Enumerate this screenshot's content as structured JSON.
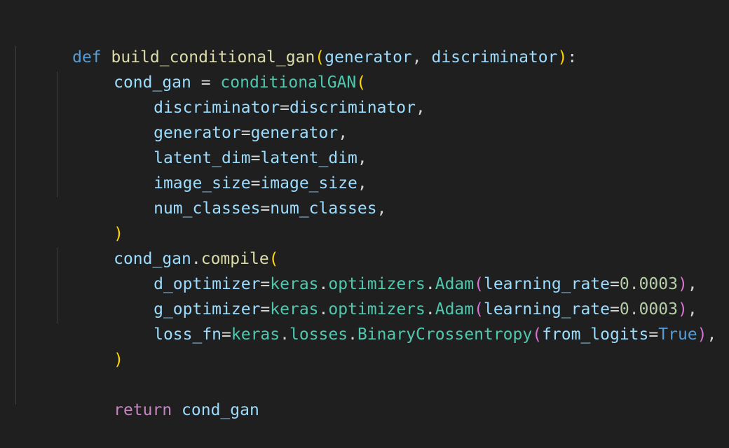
{
  "code": {
    "l1": {
      "kw": "def",
      "fn": "build_conditional_gan",
      "open": "(",
      "p1": "generator",
      "comma": ", ",
      "p2": "discriminator",
      "close": ")",
      "colon": ":"
    },
    "l2": {
      "var": "cond_gan",
      "eq": " = ",
      "cls": "conditionalGAN",
      "open": "("
    },
    "args1": [
      {
        "name": "discriminator",
        "value": "discriminator"
      },
      {
        "name": "generator",
        "value": "generator"
      },
      {
        "name": "latent_dim",
        "value": "latent_dim"
      },
      {
        "name": "image_size",
        "value": "image_size"
      },
      {
        "name": "num_classes",
        "value": "num_classes"
      }
    ],
    "close1": ")",
    "l8": {
      "obj": "cond_gan",
      "dot": ".",
      "method": "compile",
      "open": "("
    },
    "args2": [
      {
        "name": "d_optimizer",
        "mod": "keras",
        "sub": "optimizers",
        "cls": "Adam",
        "kw": "learning_rate",
        "val": "0.0003"
      },
      {
        "name": "g_optimizer",
        "mod": "keras",
        "sub": "optimizers",
        "cls": "Adam",
        "kw": "learning_rate",
        "val": "0.0003"
      },
      {
        "name": "loss_fn",
        "mod": "keras",
        "sub": "losses",
        "cls": "BinaryCrossentropy",
        "kw": "from_logits",
        "val": "True"
      }
    ],
    "close2": ")",
    "ret": {
      "kw": "return",
      "var": "cond_gan"
    },
    "punct": {
      "eq": "=",
      "comma": ",",
      "dot": ".",
      "open": "(",
      "close": ")",
      "space": " "
    }
  },
  "colors": {
    "background": "#1f1f1f",
    "keyword": "#569cd6",
    "control": "#c586c0",
    "function": "#dcdcaa",
    "class": "#4ec9b0",
    "variable": "#9cdcfe",
    "number": "#b5cea8",
    "bracket1": "#ffd700",
    "bracket2": "#da70d6",
    "bracket3": "#179fff"
  }
}
